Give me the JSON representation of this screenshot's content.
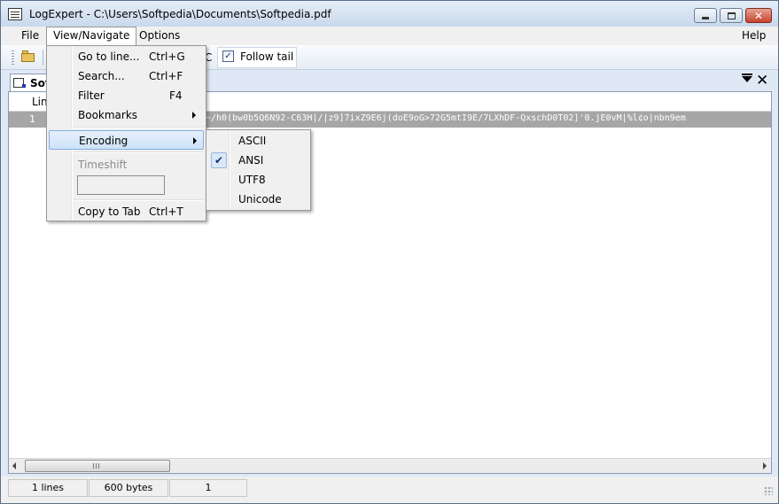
{
  "window": {
    "title": "LogExpert - C:\\Users\\Softpedia\\Documents\\Softpedia.pdf",
    "minimize_label": "",
    "maximize_label": "",
    "close_label": "✕"
  },
  "menubar": {
    "file": "File",
    "view_navigate": "View/Navigate",
    "options": "Options",
    "help": "Help"
  },
  "toolbar": {
    "partial_text": "C",
    "follow_tail_label": "Follow tail",
    "follow_tail_checked": "✓"
  },
  "tab": {
    "label": "Sof",
    "close_glyph": "✕"
  },
  "grid": {
    "column_header": "Lin",
    "rows": [
      {
        "line": "1",
        "text": "~/h0(bw0b5Q6N92-C63H|/|z9]7ixZ9E6j(doE9oG>72G5mtI9E/7LXhDF-QxschD0T02]'0.jE0vM|%l¢o|nbn9em"
      }
    ],
    "scroll_grip": ""
  },
  "status": {
    "lines": "1 lines",
    "bytes": "600 bytes",
    "position": "1"
  },
  "view_menu": {
    "items": [
      {
        "label": "Go to line...",
        "shortcut": "Ctrl+G"
      },
      {
        "label": "Search...",
        "shortcut": "Ctrl+F"
      },
      {
        "label": "Filter",
        "shortcut": "F4"
      },
      {
        "label": "Bookmarks",
        "shortcut": ""
      },
      {
        "label": "Encoding",
        "shortcut": ""
      },
      {
        "label": "Timeshift",
        "shortcut": ""
      },
      {
        "label": "Copy to Tab",
        "shortcut": "Ctrl+T"
      }
    ],
    "timeshift_value": ""
  },
  "encoding_menu": {
    "items": [
      "ASCII",
      "ANSI",
      "UTF8",
      "Unicode"
    ],
    "selected": "ANSI",
    "check_glyph": "✔"
  },
  "colors": {
    "selected_row": "#a6a6a6",
    "menu_highlight": "#cde2f8",
    "titlebar": "#c9d8ec"
  }
}
